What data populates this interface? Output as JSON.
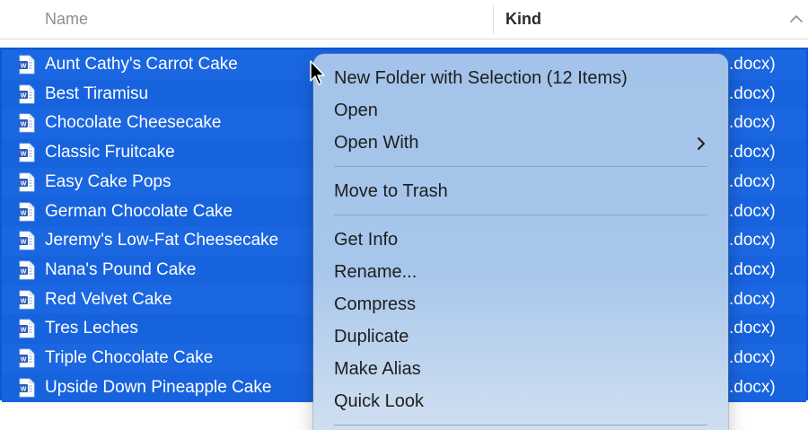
{
  "header": {
    "name_label": "Name",
    "kind_label": "Kind",
    "sort_icon": "chevron-up-icon"
  },
  "files": [
    {
      "name": "Aunt Cathy's Carrot Cake",
      "kind": ".docx)"
    },
    {
      "name": "Best Tiramisu",
      "kind": ".docx)"
    },
    {
      "name": "Chocolate Cheesecake",
      "kind": ".docx)"
    },
    {
      "name": "Classic Fruitcake",
      "kind": ".docx)"
    },
    {
      "name": "Easy Cake Pops",
      "kind": ".docx)"
    },
    {
      "name": "German Chocolate Cake",
      "kind": ".docx)"
    },
    {
      "name": "Jeremy's Low-Fat Cheesecake",
      "kind": ".docx)"
    },
    {
      "name": "Nana's Pound Cake",
      "kind": ".docx)"
    },
    {
      "name": "Red Velvet Cake",
      "kind": ".docx)"
    },
    {
      "name": "Tres Leches",
      "kind": ".docx)"
    },
    {
      "name": "Triple Chocolate Cake",
      "kind": ".docx)"
    },
    {
      "name": "Upside Down Pineapple Cake",
      "kind": ".docx)"
    }
  ],
  "file_icon": "word-document-icon",
  "context_menu": {
    "groups": [
      [
        {
          "label": "New Folder with Selection (12 Items)"
        },
        {
          "label": "Open"
        },
        {
          "label": "Open With",
          "submenu": true
        }
      ],
      [
        {
          "label": "Move to Trash"
        }
      ],
      [
        {
          "label": "Get Info"
        },
        {
          "label": "Rename..."
        },
        {
          "label": "Compress"
        },
        {
          "label": "Duplicate"
        },
        {
          "label": "Make Alias"
        },
        {
          "label": "Quick Look"
        }
      ]
    ]
  },
  "colors": {
    "selection": "#1b66e1",
    "menu_background": "#a7c6eb",
    "header_text": "#8e8e93"
  }
}
